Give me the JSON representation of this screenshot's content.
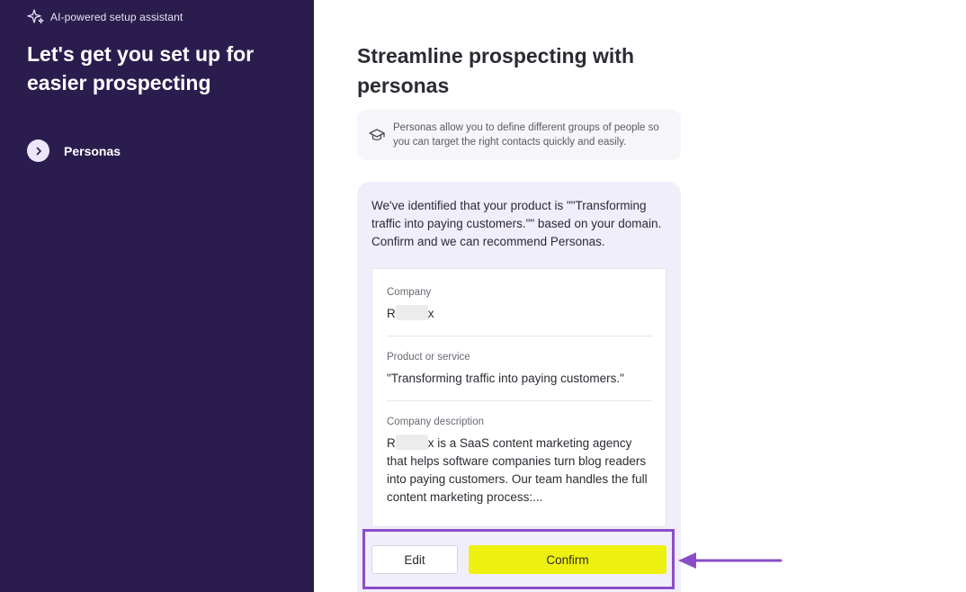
{
  "sidebar": {
    "assistant_label": "AI-powered setup assistant",
    "title": "Let's get you set up for easier prospecting",
    "steps": [
      {
        "label": "Personas",
        "icon": "chevron-right-icon"
      }
    ]
  },
  "main": {
    "title": "Streamline prospecting with personas",
    "info": {
      "icon": "graduation-cap-icon",
      "text": "Personas allow you to define different groups of people so you can target the right contacts quickly and easily."
    },
    "card": {
      "intro": "We've identified that your product is \"\"Transforming traffic into paying customers.\"\" based on your domain. Confirm and we can recommend Personas.",
      "fields": {
        "company": {
          "label": "Company",
          "value_start": "R",
          "value_end": "x"
        },
        "product": {
          "label": "Product or service",
          "value": "\"Transforming traffic into paying customers.\""
        },
        "description": {
          "label": "Company description",
          "value_start": "R",
          "value_end": "x is a SaaS content marketing agency that helps software companies turn blog readers into paying customers. Our team handles the full content marketing process:..."
        }
      },
      "actions": {
        "edit_label": "Edit",
        "confirm_label": "Confirm"
      }
    }
  },
  "colors": {
    "sidebar_bg": "#2a1d4e",
    "card_bg": "#f1eefb",
    "confirm_bg": "#eef10f",
    "highlight": "#8a4dc9"
  }
}
